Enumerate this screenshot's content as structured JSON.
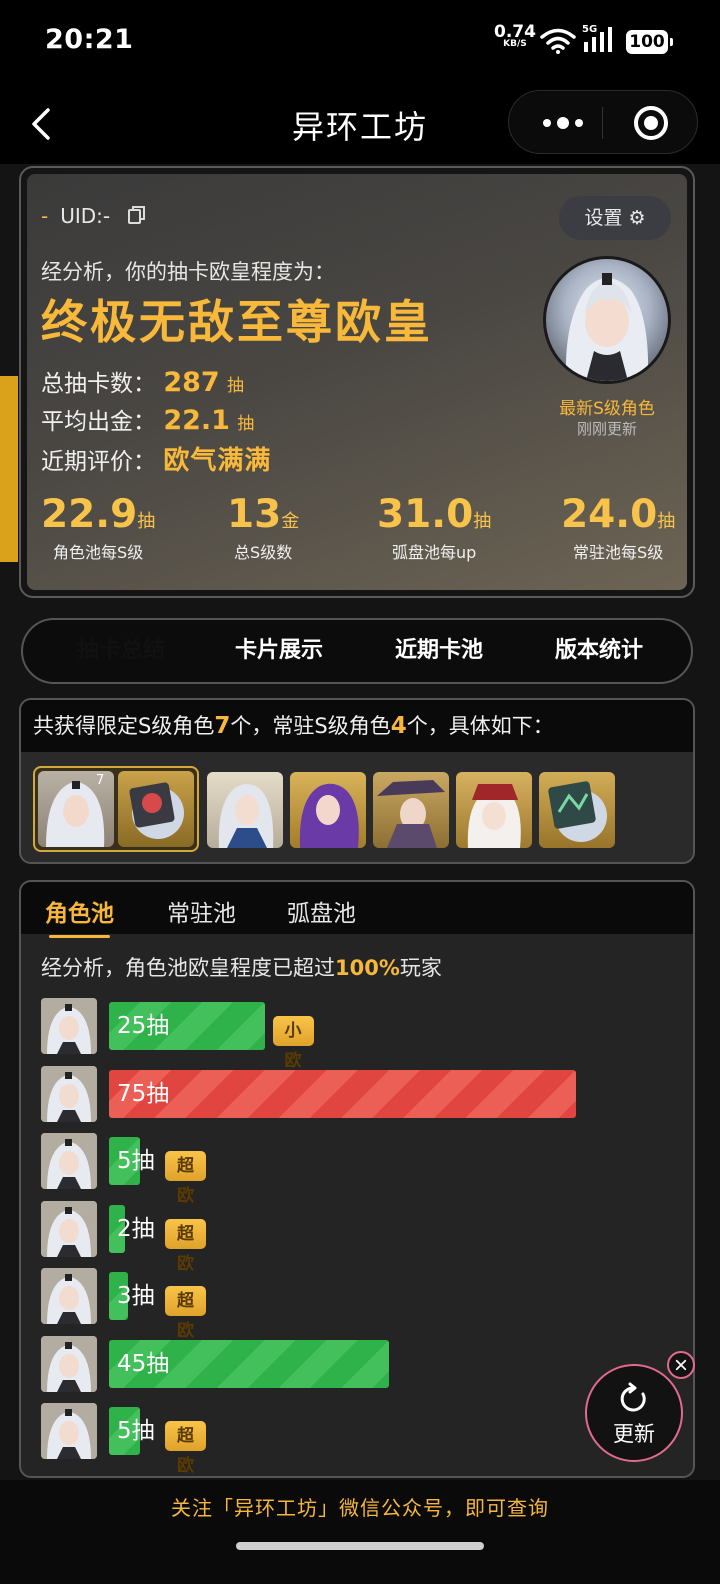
{
  "status_bar": {
    "time": "20:21",
    "net_speed": "0.74",
    "net_unit": "KB/S",
    "signal_label": "5G",
    "battery": "100"
  },
  "nav": {
    "title": "异环工坊"
  },
  "profile": {
    "uid_prefix": "-",
    "uid": "UID:-",
    "settings_label": "设置 ⚙",
    "analysis_text": "经分析，你的抽卡欧皇程度为：",
    "rank_title": "终极无敌至尊欧皇",
    "total_pulls_label": "总抽卡数：",
    "total_pulls_value": "287",
    "pull_unit": "抽",
    "avg_label": "平均出金：",
    "avg_value": "22.1",
    "recent_label": "近期评价：",
    "recent_value": "欧气满满",
    "avatar_caption": "最新S级角色",
    "avatar_sub": "刚刚更新",
    "metrics": [
      {
        "value": "22.9",
        "unit": "抽",
        "label": "角色池每S级"
      },
      {
        "value": "13",
        "unit": "金",
        "label": "总S级数"
      },
      {
        "value": "31.0",
        "unit": "抽",
        "label": "弧盘池每up"
      },
      {
        "value": "24.0",
        "unit": "抽",
        "label": "常驻池每S级"
      }
    ]
  },
  "tabs": [
    "抽卡总结",
    "卡片展示",
    "近期卡池",
    "版本统计"
  ],
  "owned": {
    "text_a": "共获得限定S级角色",
    "limited_count": "7",
    "text_b": "个，常驻S级角色",
    "standard_count": "4",
    "text_c": "个，具体如下：",
    "first_count": "7"
  },
  "pool": {
    "tabs": [
      "角色池",
      "常驻池",
      "弧盘池"
    ],
    "desc_a": "经分析，角色池欧皇程度已超过",
    "desc_pct": "100%",
    "desc_b": "玩家",
    "rows": [
      {
        "label": "25抽",
        "pulls": 25,
        "color": "green",
        "badge": "小欧"
      },
      {
        "label": "75抽",
        "pulls": 75,
        "color": "red",
        "badge": ""
      },
      {
        "label": "5抽",
        "pulls": 5,
        "color": "green",
        "badge": "超欧"
      },
      {
        "label": "2抽",
        "pulls": 2,
        "color": "green",
        "badge": "超欧"
      },
      {
        "label": "3抽",
        "pulls": 3,
        "color": "green",
        "badge": "超欧"
      },
      {
        "label": "45抽",
        "pulls": 45,
        "color": "green",
        "badge": ""
      },
      {
        "label": "5抽",
        "pulls": 5,
        "color": "green",
        "badge": "超欧"
      }
    ]
  },
  "fab": {
    "label": "更新"
  },
  "footer": {
    "text": "关注「异环工坊」微信公众号，即可查询"
  },
  "colors": {
    "accent": "#f6b73c",
    "tab_active": "#dcd520",
    "bar_green": "#2fb24a",
    "bar_red": "#e0463f",
    "fab_ring": "#e36a8d"
  }
}
